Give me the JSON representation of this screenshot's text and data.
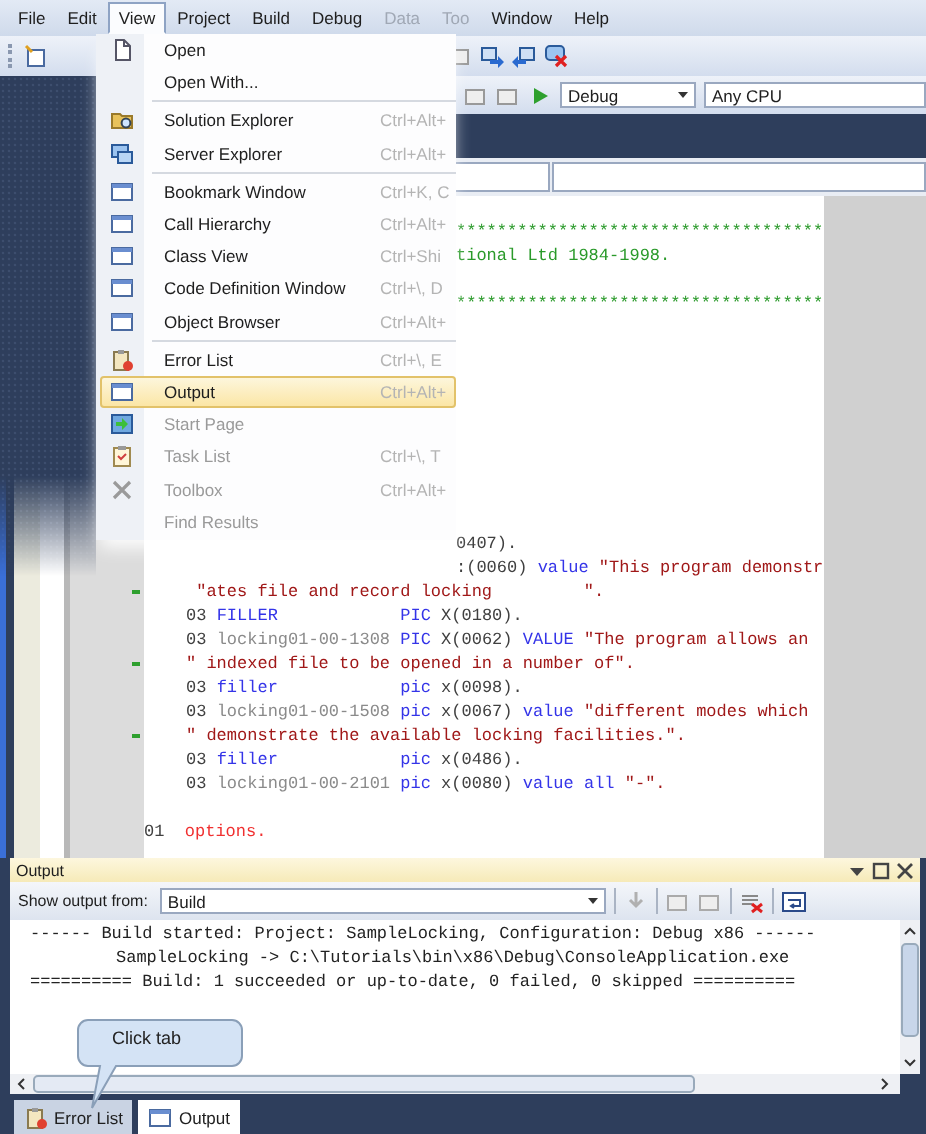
{
  "menu_bar": [
    {
      "label": "File",
      "selected": false,
      "disabled": false
    },
    {
      "label": "Edit",
      "selected": false,
      "disabled": false
    },
    {
      "label": "View",
      "selected": true,
      "disabled": false
    },
    {
      "label": "Project",
      "selected": false,
      "disabled": false
    },
    {
      "label": "Build",
      "selected": false,
      "disabled": false
    },
    {
      "label": "Debug",
      "selected": false,
      "disabled": false
    },
    {
      "label": "Data",
      "selected": false,
      "disabled": true
    },
    {
      "label": "Too",
      "selected": false,
      "disabled": true
    },
    {
      "label": "Window",
      "selected": false,
      "disabled": false
    },
    {
      "label": "Help",
      "selected": false,
      "disabled": false
    }
  ],
  "toolbar": {
    "configuration": "Debug",
    "platform": "Any CPU"
  },
  "view_menu": {
    "items": [
      {
        "kind": "item",
        "label": "Open",
        "selected": false,
        "disabled": false
      },
      {
        "kind": "item",
        "label": "Open With...",
        "selected": false,
        "disabled": false
      },
      {
        "kind": "separator"
      },
      {
        "kind": "item",
        "label": "Solution Explorer",
        "shortcut": "Ctrl+Alt+",
        "selected": false,
        "disabled": false
      },
      {
        "kind": "item",
        "label": "Server Explorer",
        "shortcut": "Ctrl+Alt+",
        "selected": false,
        "disabled": false
      },
      {
        "kind": "separator"
      },
      {
        "kind": "item",
        "label": "Bookmark Window",
        "shortcut": "Ctrl+K, C",
        "selected": false,
        "disabled": false
      },
      {
        "kind": "item",
        "label": "Call Hierarchy",
        "shortcut": "Ctrl+Alt+",
        "selected": false,
        "disabled": false
      },
      {
        "kind": "item",
        "label": "Class View",
        "shortcut": "Ctrl+Shi",
        "selected": false,
        "disabled": false
      },
      {
        "kind": "item",
        "label": "Code Definition Window",
        "shortcut": "Ctrl+\\, D",
        "selected": false,
        "disabled": false
      },
      {
        "kind": "item",
        "label": "Object Browser",
        "shortcut": "Ctrl+Alt+",
        "selected": false,
        "disabled": false
      },
      {
        "kind": "separator"
      },
      {
        "kind": "item",
        "label": "Error List",
        "shortcut": "Ctrl+\\, E",
        "selected": false,
        "disabled": false
      },
      {
        "kind": "item",
        "label": "Output",
        "shortcut": "Ctrl+Alt+",
        "selected": true,
        "disabled": false
      },
      {
        "kind": "item",
        "label": "Start Page",
        "selected": false,
        "disabled": true
      },
      {
        "kind": "item",
        "label": "Task List",
        "shortcut": "Ctrl+\\, T",
        "selected": false,
        "disabled": true
      },
      {
        "kind": "item",
        "label": "Toolbox",
        "shortcut": "Ctrl+Alt+",
        "selected": false,
        "disabled": true
      },
      {
        "kind": "item",
        "label": "Find Results",
        "selected": false,
        "disabled": true
      }
    ]
  },
  "editor": {
    "lines": [
      {
        "kind": "partial",
        "marker": false,
        "segments": [
          {
            "kind": "comment",
            "text": "************************************"
          }
        ]
      },
      {
        "kind": "partial",
        "marker": false,
        "segments": [
          {
            "kind": "comment",
            "text": "tional Ltd 1984-1998."
          }
        ]
      },
      {
        "kind": "blank"
      },
      {
        "kind": "partial",
        "marker": false,
        "segments": [
          {
            "kind": "comment",
            "text": "************************************"
          }
        ]
      },
      {
        "kind": "blank"
      },
      {
        "kind": "blank"
      },
      {
        "kind": "blank"
      },
      {
        "kind": "blank"
      },
      {
        "kind": "blank"
      },
      {
        "kind": "blank"
      },
      {
        "kind": "blank"
      },
      {
        "kind": "blank"
      },
      {
        "kind": "blank"
      },
      {
        "kind": "partial",
        "marker": false,
        "segments": [
          {
            "kind": "plain",
            "text": "0407)."
          }
        ]
      },
      {
        "kind": "partial",
        "marker": false,
        "segments": [
          {
            "kind": "plain",
            "text": ":(0060) "
          },
          {
            "kind": "keyword",
            "text": "value"
          },
          {
            "kind": "string",
            "text": " \"This program demonstr"
          }
        ]
      },
      {
        "kind": "full",
        "marker": true,
        "segments": [
          {
            "kind": "string",
            "text": " \"ates file and record locking         \"."
          }
        ]
      },
      {
        "kind": "full",
        "marker": false,
        "segments": [
          {
            "kind": "plain",
            "text": "03 "
          },
          {
            "kind": "keyword",
            "text": "FILLER            PIC"
          },
          {
            "kind": "plain",
            "text": " X(0180)."
          }
        ]
      },
      {
        "kind": "full",
        "marker": false,
        "segments": [
          {
            "kind": "plain",
            "text": "03 "
          },
          {
            "kind": "ident",
            "text": "locking01-00-1308"
          },
          {
            "kind": "keyword",
            "text": " PIC"
          },
          {
            "kind": "plain",
            "text": " X(0062) "
          },
          {
            "kind": "keyword",
            "text": "VALUE"
          },
          {
            "kind": "string",
            "text": " \"The program allows an"
          }
        ]
      },
      {
        "kind": "full",
        "marker": true,
        "segments": [
          {
            "kind": "string",
            "text": "\" indexed file to be opened in a number of\"."
          }
        ]
      },
      {
        "kind": "full",
        "marker": false,
        "segments": [
          {
            "kind": "plain",
            "text": "03 "
          },
          {
            "kind": "keyword",
            "text": "filler            pic"
          },
          {
            "kind": "plain",
            "text": " x(0098)."
          }
        ]
      },
      {
        "kind": "full",
        "marker": false,
        "segments": [
          {
            "kind": "plain",
            "text": "03 "
          },
          {
            "kind": "ident",
            "text": "locking01-00-1508"
          },
          {
            "kind": "keyword",
            "text": " pic"
          },
          {
            "kind": "plain",
            "text": " x(0067) "
          },
          {
            "kind": "keyword",
            "text": "value"
          },
          {
            "kind": "string",
            "text": " \"different modes which"
          }
        ]
      },
      {
        "kind": "full",
        "marker": true,
        "segments": [
          {
            "kind": "string",
            "text": "\" demonstrate the available locking facilities.\"."
          }
        ]
      },
      {
        "kind": "full",
        "marker": false,
        "segments": [
          {
            "kind": "plain",
            "text": "03 "
          },
          {
            "kind": "keyword",
            "text": "filler            pic"
          },
          {
            "kind": "plain",
            "text": " x(0486)."
          }
        ]
      },
      {
        "kind": "full",
        "marker": false,
        "segments": [
          {
            "kind": "plain",
            "text": "03 "
          },
          {
            "kind": "ident",
            "text": "locking01-00-2101"
          },
          {
            "kind": "keyword",
            "text": " pic"
          },
          {
            "kind": "plain",
            "text": " x(0080) "
          },
          {
            "kind": "keyword",
            "text": "value all"
          },
          {
            "kind": "string",
            "text": " \"-\"."
          }
        ]
      },
      {
        "kind": "blank"
      },
      {
        "kind": "level",
        "marker": false,
        "segments": [
          {
            "kind": "plain",
            "text": "01  "
          },
          {
            "kind": "label",
            "text": "options."
          }
        ]
      }
    ]
  },
  "output": {
    "title": "Output",
    "source_label": "Show output from:",
    "source": "Build",
    "lines": [
      {
        "text": "------ Build started: Project: SampleLocking, Configuration: Debug x86 ------",
        "indented": false
      },
      {
        "text": "SampleLocking -> C:\\Tutorials\\bin\\x86\\Debug\\ConsoleApplication.exe",
        "indented": true
      },
      {
        "text": "========== Build: 1 succeeded or up-to-date, 0 failed, 0 skipped ==========",
        "indented": false
      }
    ]
  },
  "bottom_tabs": [
    {
      "label": "Error List",
      "selected": false
    },
    {
      "label": "Output",
      "selected": true
    }
  ],
  "callout": "Click tab"
}
